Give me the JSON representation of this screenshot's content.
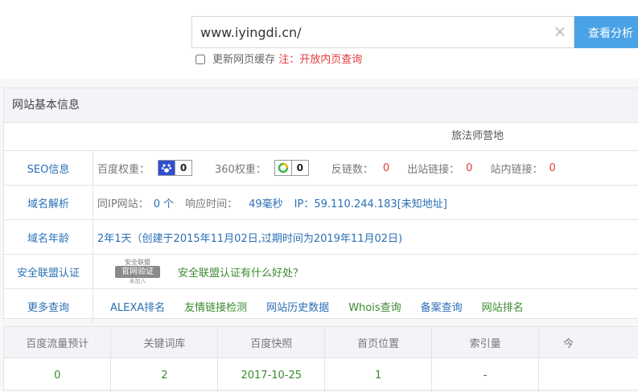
{
  "search": {
    "value": "www.iyingdi.cn/",
    "clear_glyph": "×",
    "button_label": "查看分析",
    "cache_label": "更新网页缓存",
    "note_label": "注：开放内页查询"
  },
  "panel": {
    "title": "网站基本信息",
    "site_title": "旅法师营地",
    "seo": {
      "label": "SEO信息",
      "baidu_label": "百度权重：",
      "baidu_value": "0",
      "w360_label": "360权重：",
      "w360_value": "0",
      "backlinks_label": "反链数：",
      "backlinks_value": "0",
      "outlinks_label": "出站链接：",
      "outlinks_value": "0",
      "inlinks_label": "站内链接：",
      "inlinks_value": "0"
    },
    "dns": {
      "label": "域名解析",
      "sameip_label": "同IP网站：",
      "sameip_value": "0 个",
      "resp_label": "响应时间：",
      "resp_value": "49毫秒",
      "ip_text": "IP：59.110.244.183[未知地址]"
    },
    "age": {
      "label": "域名年龄",
      "text": "2年1天（创建于2015年11月02日,过期时间为2019年11月02日)"
    },
    "security": {
      "label": "安全联盟认证",
      "seal_top": "安全联盟",
      "seal_main": "官网验证",
      "seal_bottom": "未加入",
      "link": "安全联盟认证有什么好处？"
    },
    "more": {
      "label": "更多查询",
      "links": [
        "ALEXA排名",
        "友情链接检测",
        "网站历史数据",
        "Whois查询",
        "备案查询",
        "网站排名"
      ]
    }
  },
  "stats": {
    "headers": [
      "百度流量预计",
      "关键词库",
      "百度快照",
      "首页位置",
      "索引量",
      "今"
    ],
    "values": [
      "0",
      "2",
      "2017-10-25",
      "1",
      "-",
      ""
    ]
  },
  "colors": {
    "accent": "#4aa3e6",
    "link": "#2a6fb5",
    "red": "#e4393c",
    "green": "#3a8a2e"
  }
}
